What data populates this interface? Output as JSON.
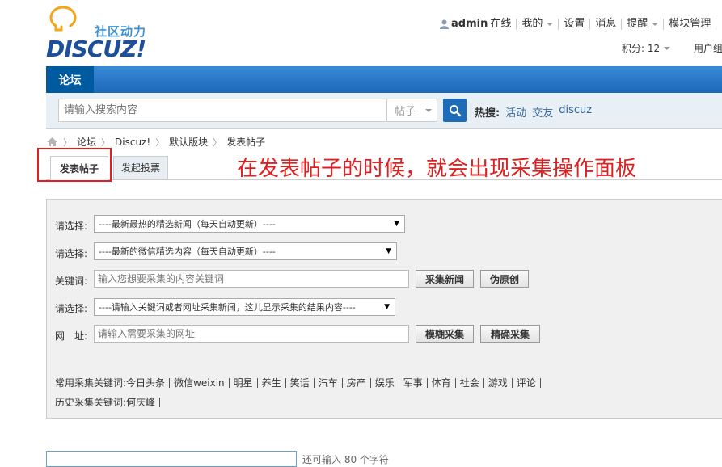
{
  "logo": {
    "subtitle": "社区动力",
    "brand": "DISCUZ!"
  },
  "topnav": {
    "username": "admin",
    "status": "在线",
    "mine": "我的",
    "settings": "设置",
    "messages": "消息",
    "reminders": "提醒",
    "module_manage": "模块管理",
    "manage": "管理",
    "score": "积分: 12",
    "user_group": "用户组"
  },
  "nav": {
    "forum": "论坛"
  },
  "search": {
    "placeholder": "请输入搜索内容",
    "type": "帖子",
    "hot_label": "热搜:",
    "hot_keywords": [
      "活动",
      "交友",
      "discuz"
    ]
  },
  "breadcrumb": {
    "items": [
      "论坛",
      "Discuz!",
      "默认版块",
      "发表帖子"
    ]
  },
  "tabs": {
    "post": "发表帖子",
    "poll": "发起投票"
  },
  "annotation": "在发表帖子的时候，就会出现采集操作面板",
  "panel": {
    "select_label": "请选择:",
    "select1": "----最新最热的精选新闻（每天自动更新）----",
    "select2": "----最新的微信精选内容（每天自动更新）----",
    "keyword_label": "关键词:",
    "keyword_placeholder": "输入您想要采集的内容关键词",
    "btn_collect_news": "采集新闻",
    "btn_pseudo_original": "伪原创",
    "select3": "----请输入关键词或者网址采集新闻，这儿显示采集的结果内容----",
    "url_label": "网　址:",
    "url_placeholder": "请输入需要采集的网址",
    "btn_fuzzy": "模糊采集",
    "btn_exact": "精确采集",
    "common_label": "常用采集关键词:",
    "common_keywords": [
      "今日头条",
      "微信weixin",
      "明星",
      "养生",
      "笑话",
      "汽车",
      "房产",
      "娱乐",
      "军事",
      "体育",
      "社会",
      "游戏",
      "评论"
    ],
    "history_label": "历史采集关键词:",
    "history_keywords": [
      "何庆峰"
    ]
  },
  "footer": {
    "hint": "还可输入 80 个字符"
  }
}
